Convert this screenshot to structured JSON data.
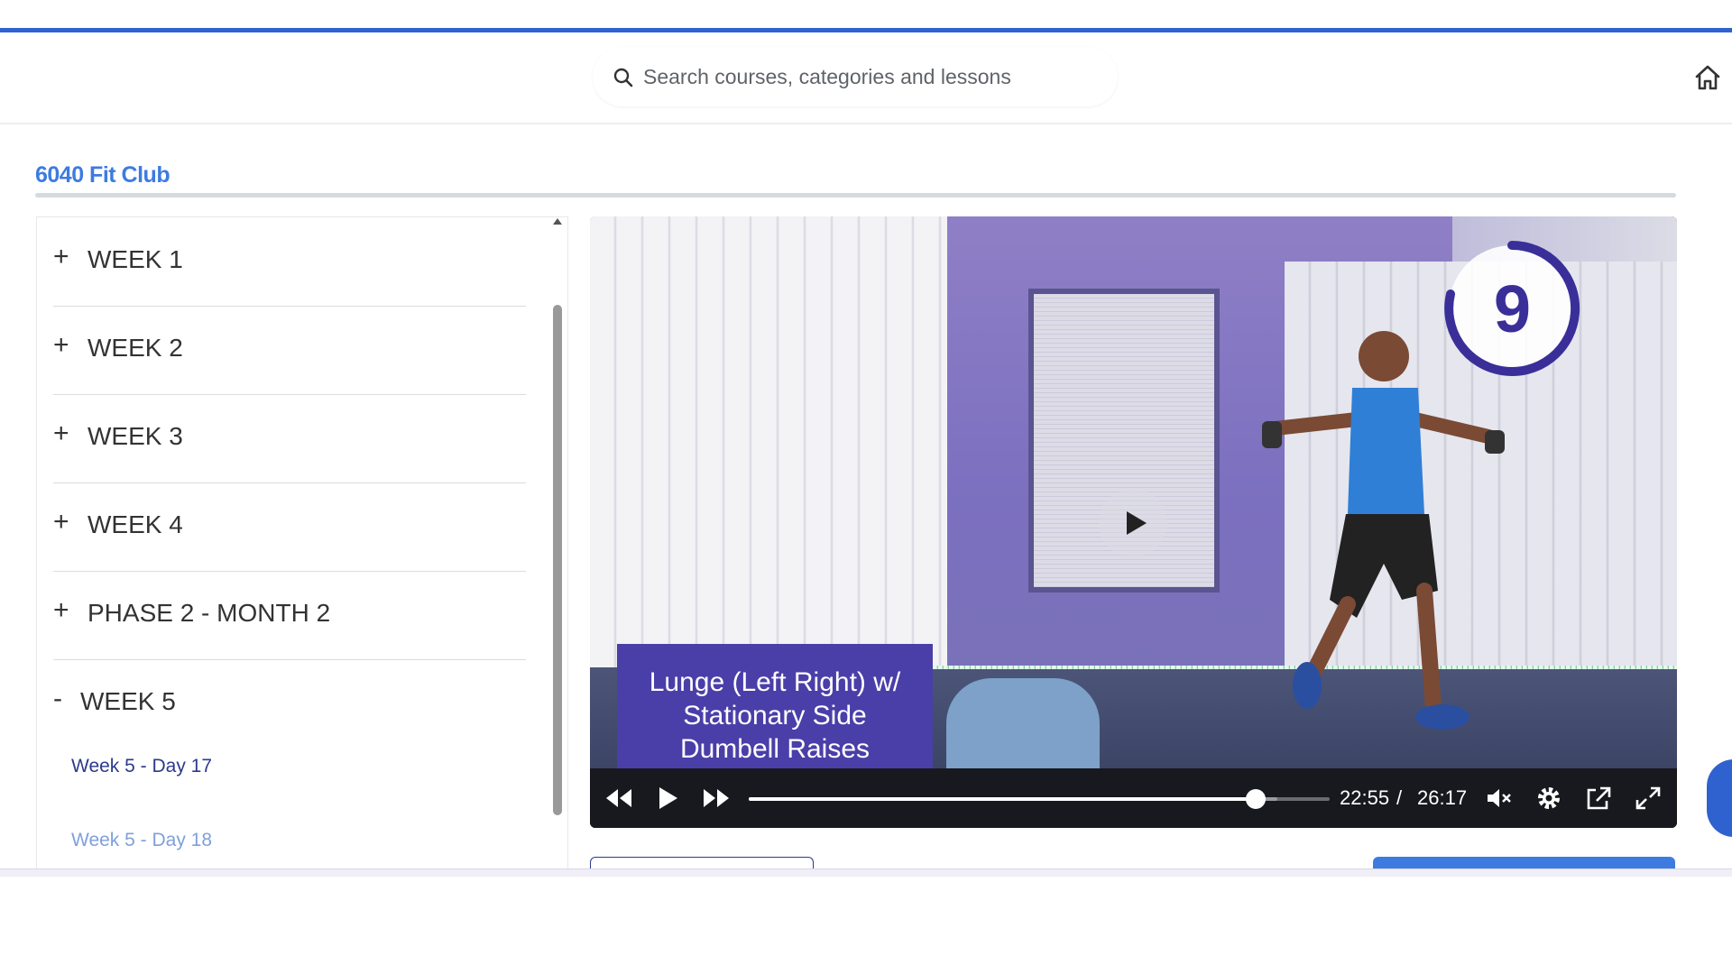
{
  "header": {
    "search_placeholder": "Search courses, categories and lessons",
    "home_icon": "home-icon"
  },
  "course": {
    "title": "6040 Fit Club"
  },
  "sidebar": {
    "sections": [
      {
        "sign": "+",
        "label": "WEEK 1"
      },
      {
        "sign": "+",
        "label": "WEEK 2"
      },
      {
        "sign": "+",
        "label": "WEEK 3"
      },
      {
        "sign": "+",
        "label": "WEEK 4"
      },
      {
        "sign": "+",
        "label": "PHASE 2 - MONTH 2"
      },
      {
        "sign": "-",
        "label": "WEEK 5"
      }
    ],
    "lessons": [
      {
        "label": "Week 5 - Day 17",
        "state": "current"
      },
      {
        "label": "Week 5 - Day 18",
        "state": "upcoming"
      }
    ]
  },
  "video": {
    "caption_lines": [
      "Lunge (Left Right) w/",
      "Stationary Side",
      "Dumbell Raises"
    ],
    "timer_count": "9",
    "current_time": "22:55",
    "separator": "/",
    "duration": "26:17",
    "progress_fraction": 0.873,
    "buffered_fraction": 0.91,
    "colors": {
      "caption_bg": "#4a3fa8",
      "timer_ring": "#3a2f99",
      "controls_bg": "#18191f"
    },
    "controls": {
      "rewind_icon": "rewind-icon",
      "play_icon": "play-icon",
      "forward_icon": "fast-forward-icon",
      "mute_icon": "volume-muted-icon",
      "settings_icon": "gear-icon",
      "popout_icon": "external-link-icon",
      "fullscreen_icon": "fullscreen-icon"
    }
  },
  "colors": {
    "accent": "#2f62cf",
    "title": "#3d7be0",
    "lesson_active": "#2d3a8c",
    "lesson_dim": "#7fa0dc"
  }
}
